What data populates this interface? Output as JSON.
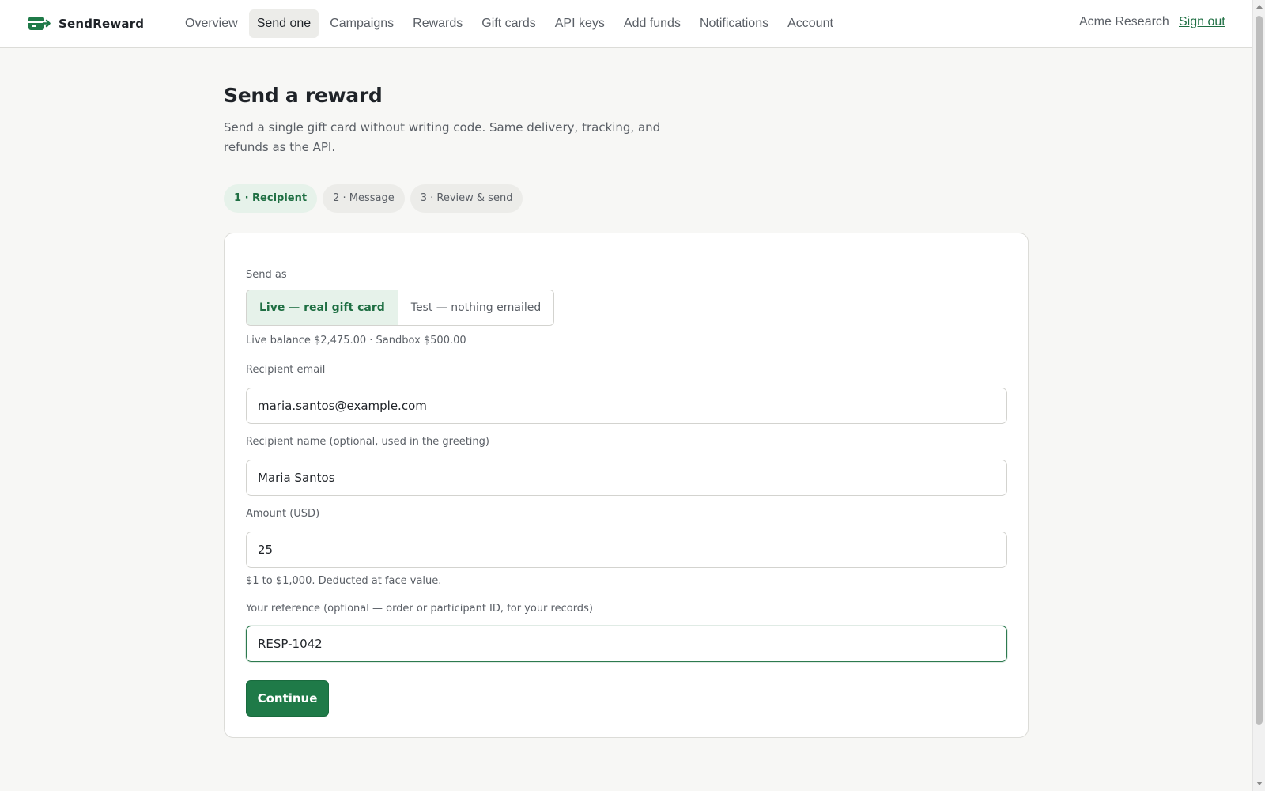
{
  "brand": {
    "name": "SendReward",
    "icon": "gift-card-arrow-icon",
    "color": "#1f7a48"
  },
  "nav": {
    "items": [
      {
        "label": "Overview",
        "active": false
      },
      {
        "label": "Send one",
        "active": true
      },
      {
        "label": "Campaigns",
        "active": false
      },
      {
        "label": "Rewards",
        "active": false
      },
      {
        "label": "Gift cards",
        "active": false
      },
      {
        "label": "API keys",
        "active": false
      },
      {
        "label": "Add funds",
        "active": false
      },
      {
        "label": "Notifications",
        "active": false
      },
      {
        "label": "Account",
        "active": false
      }
    ],
    "account_name": "Acme Research",
    "signout_label": "Sign out"
  },
  "page": {
    "title": "Send a reward",
    "subtitle": "Send a single gift card without writing code. Same delivery, tracking, and refunds as the API."
  },
  "steps": [
    {
      "label": "1 · Recipient",
      "active": true
    },
    {
      "label": "2 · Message",
      "active": false
    },
    {
      "label": "3 · Review & send",
      "active": false
    }
  ],
  "form": {
    "send_as": {
      "label": "Send as",
      "options": [
        "Live — real gift card",
        "Test — nothing emailed"
      ],
      "selected": "Live — real gift card"
    },
    "balance_hint": "Live balance $2,475.00 · Sandbox $500.00",
    "email": {
      "label": "Recipient email",
      "value": "maria.santos@example.com"
    },
    "name": {
      "label": "Recipient name (optional, used in the greeting)",
      "value": "Maria Santos"
    },
    "amount": {
      "label": "Amount (USD)",
      "value": "25",
      "hint": "$1 to $1,000. Deducted at face value."
    },
    "reference": {
      "label": "Your reference (optional — order or participant ID, for your records)",
      "value": "RESP-1042"
    },
    "continue_label": "Continue"
  },
  "colors": {
    "accent": "#1f7a48",
    "accent_soft": "#e6f2ea",
    "background": "#f7f7f5"
  }
}
